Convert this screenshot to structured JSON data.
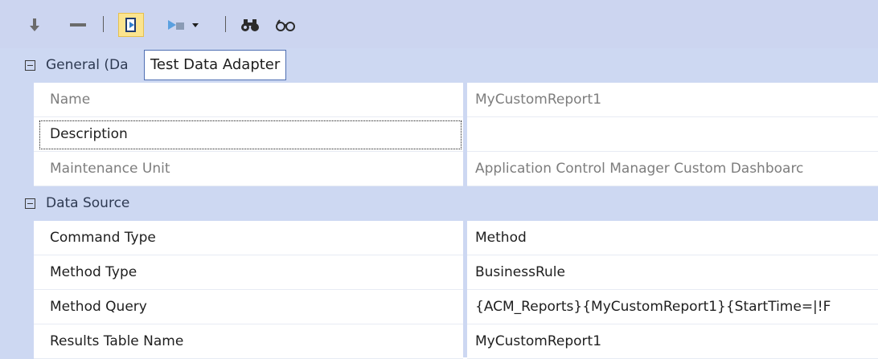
{
  "toolbar": {
    "buttons": [
      {
        "name": "move-down",
        "icon": "arrow-down-icon"
      },
      {
        "name": "remove",
        "icon": "minus-icon"
      },
      {
        "name": "test-data-adapter",
        "icon": "test-data-adapter-icon",
        "selected": true
      },
      {
        "name": "run-dropdown",
        "icon": "run-dropdown-icon"
      },
      {
        "name": "find",
        "icon": "binoculars-icon"
      },
      {
        "name": "view",
        "icon": "glasses-icon"
      }
    ]
  },
  "tooltip": {
    "text": "Test Data Adapter"
  },
  "grid": {
    "categories": [
      {
        "label": "General (Da",
        "expanded": true
      },
      {
        "label": "Data Source",
        "expanded": true
      }
    ],
    "general": [
      {
        "name": "Name",
        "value": "MyCustomReport1",
        "readonly": true
      },
      {
        "name": "Description",
        "value": "",
        "readonly": false,
        "focused": true
      },
      {
        "name": "Maintenance Unit",
        "value": "Application Control Manager Custom Dashboarc",
        "readonly": true
      }
    ],
    "data_source": [
      {
        "name": "Command Type",
        "value": "Method"
      },
      {
        "name": "Method Type",
        "value": "BusinessRule"
      },
      {
        "name": "Method Query",
        "value": "{ACM_Reports}{MyCustomReport1}{StartTime=|!F"
      },
      {
        "name": "Results Table Name",
        "value": "MyCustomReport1"
      }
    ]
  },
  "colors": {
    "toolbar_bg": "#ccd5f0",
    "category_bg": "#cdd8f2",
    "selected_button": "#fbe48e",
    "readonly_text": "#7d7d7d"
  }
}
